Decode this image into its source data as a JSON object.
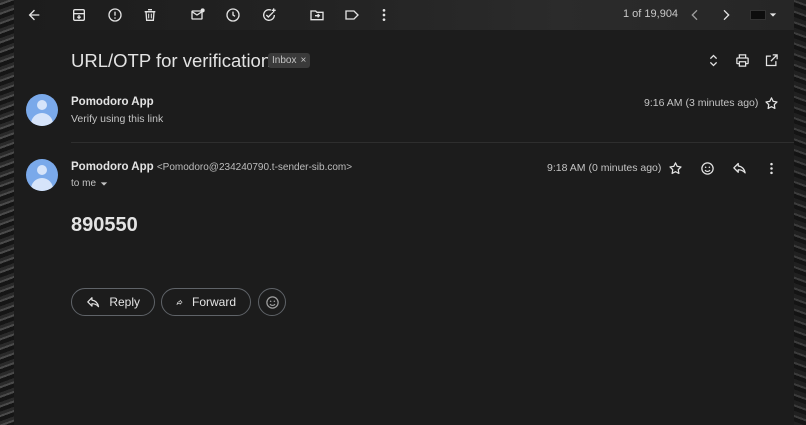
{
  "toolbar": {
    "pager_text": "1 of 19,904"
  },
  "thread": {
    "subject": "URL/OTP for verification",
    "label_chip": "Inbox",
    "label_chip_close": "×"
  },
  "messages": [
    {
      "sender": "Pomodoro App",
      "snippet": "Verify using this link",
      "time": "9:16 AM (3 minutes ago)"
    },
    {
      "sender": "Pomodoro App",
      "email": "<Pomodoro@234240790.t-sender-sib.com>",
      "recipient": "to me",
      "time": "9:18 AM (0 minutes ago)",
      "body": "890550"
    }
  ],
  "actions": {
    "reply_label": "Reply",
    "forward_label": "Forward"
  },
  "colors": {
    "background": "#1c1c1c",
    "text": "#e3e3e3",
    "avatar": "#7aa9ea"
  },
  "icons": [
    "back-arrow-icon",
    "archive-icon",
    "report-spam-icon",
    "delete-icon",
    "mark-unread-icon",
    "snooze-icon",
    "add-task-icon",
    "move-to-icon",
    "label-icon",
    "more-vert-icon",
    "chevron-left-icon",
    "chevron-right-icon",
    "expand-collapse-icon",
    "print-icon",
    "open-new-window-icon",
    "star-icon",
    "emoji-icon",
    "reply-icon",
    "forward-icon"
  ]
}
